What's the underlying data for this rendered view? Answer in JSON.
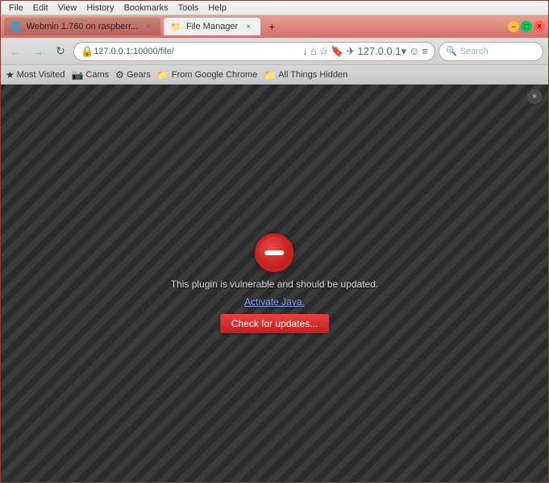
{
  "window": {
    "title": "File Manager"
  },
  "menu_bar": {
    "items": [
      "File",
      "Edit",
      "View",
      "History",
      "Bookmarks",
      "Tools",
      "Help"
    ]
  },
  "tabs": [
    {
      "label": "Webmin 1.760 on raspberr...",
      "favicon": "🌐",
      "active": false
    },
    {
      "label": "File Manager",
      "favicon": "📁",
      "active": true
    }
  ],
  "new_tab_button": "+",
  "window_controls": {
    "minimize": "−",
    "maximize": "□",
    "close": "×"
  },
  "toolbar": {
    "back": "←",
    "forward": "→",
    "reload": "↻",
    "home": "⌂",
    "address": "127.0.0.1:10000/file/",
    "address_icons": [
      "↓",
      "⌂",
      "☆",
      "🔖",
      "✈",
      "1▾",
      "☺",
      "≡"
    ],
    "search_placeholder": "Search"
  },
  "bookmarks": [
    {
      "label": "Most Visited",
      "icon": "★"
    },
    {
      "label": "Cams",
      "icon": "📷"
    },
    {
      "label": "Gears",
      "icon": "⚙"
    },
    {
      "label": "From Google Chrome",
      "icon": "📁"
    },
    {
      "label": "All Things Hidden",
      "icon": "📁"
    }
  ],
  "content": {
    "close_icon": "×",
    "block_icon_alt": "plugin blocked",
    "plugin_message": "This plugin is vulnerable and should be updated.",
    "activate_link": "Activate Java.",
    "update_button": "Check for updates..."
  }
}
